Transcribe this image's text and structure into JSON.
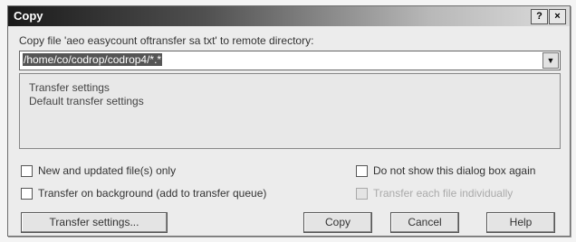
{
  "window": {
    "title": "Copy",
    "help_button": "?",
    "close_button": "×"
  },
  "prompt": "Copy file 'aeo easycount oftransfer sa txt' to remote directory:",
  "target_path": "/home/co/codrop/codrop4/*.*",
  "transfer_settings": {
    "title": "Transfer settings",
    "value": "Default transfer settings"
  },
  "options": {
    "new_updated_only": "New and updated file(s) only",
    "background": "Transfer on background (add to transfer queue)",
    "dont_show_again": "Do not show this dialog box again",
    "transfer_each_individually": "Transfer each file individually"
  },
  "buttons": {
    "transfer_settings": "Transfer settings...",
    "copy": "Copy",
    "cancel": "Cancel",
    "help": "Help"
  },
  "icons": {
    "dropdown": "chevron-down-icon",
    "help": "question-icon",
    "close": "close-icon"
  },
  "colors": {
    "titlebar_dark": "#1a1a1a",
    "titlebar_light": "#dcdcdc",
    "dialog_bg": "#ececec"
  }
}
